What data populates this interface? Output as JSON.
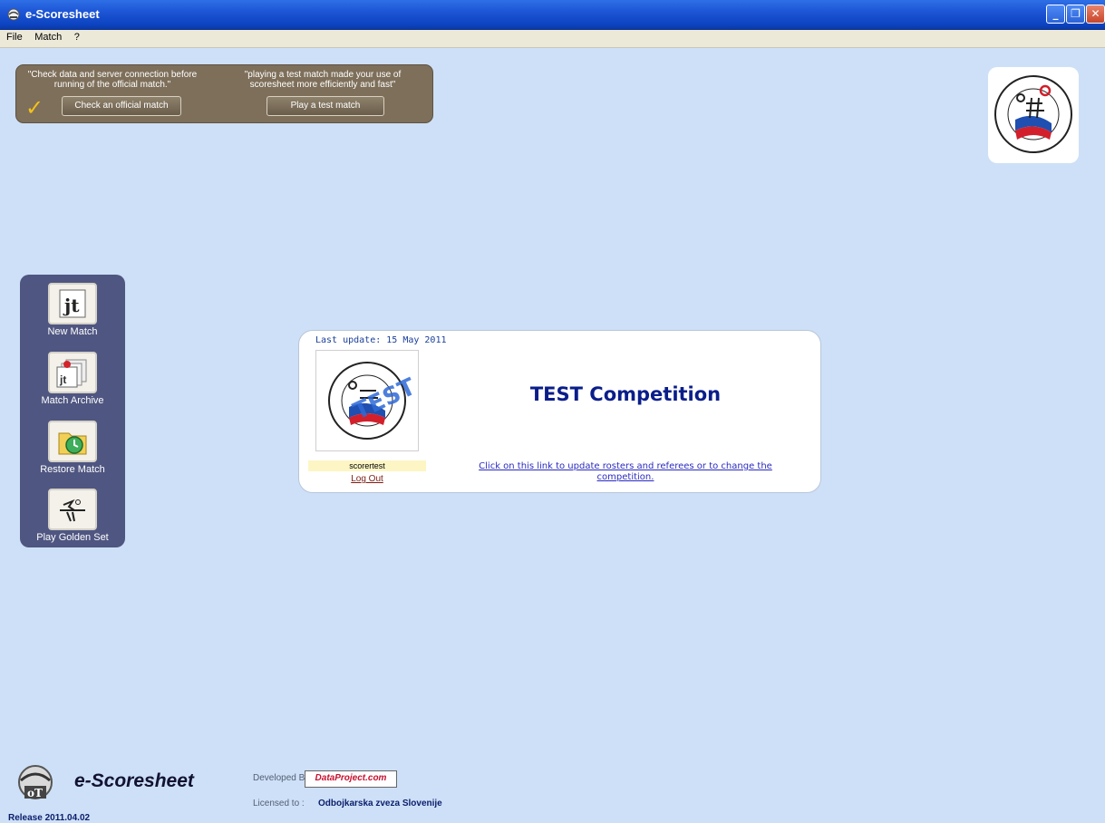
{
  "window": {
    "title": "e-Scoresheet"
  },
  "menu": {
    "items": [
      "File",
      "Match",
      "?"
    ]
  },
  "top_panel": {
    "hint_official": "\"Check data and server connection before running of the official match.\"",
    "button_official": "Check an official match",
    "hint_test": "\"playing a test match made your use of scoresheet more efficiently and fast\"",
    "button_test": "Play a test match"
  },
  "sidebar": {
    "items": [
      {
        "label": "New Match",
        "icon": "players-document-icon"
      },
      {
        "label": "Match Archive",
        "icon": "archive-icon"
      },
      {
        "label": "Restore Match",
        "icon": "restore-folder-icon"
      },
      {
        "label": "Play Golden Set",
        "icon": "golden-set-icon"
      }
    ]
  },
  "competition": {
    "last_update": "Last update: 15 May 2011",
    "title": "TEST Competition",
    "user": "scorertest",
    "logout": "Log Out",
    "update_link": "Click on this link to update rosters and referees or to change the competition."
  },
  "footer": {
    "app_name": "e-Scoresheet",
    "developed_by_label": "Developed By:",
    "developer": "DataProject.com",
    "licensed_to_label": "Licensed to :",
    "licensee": "Odbojkarska zveza Slovenije",
    "release": "Release 2011.04.02"
  },
  "colors": {
    "background": "#cde0f7",
    "titlebar": "#1d55d6",
    "panel_brown": "#7e6f5a",
    "sidebar": "#4f5681",
    "competition_title": "#0a1e8a"
  }
}
